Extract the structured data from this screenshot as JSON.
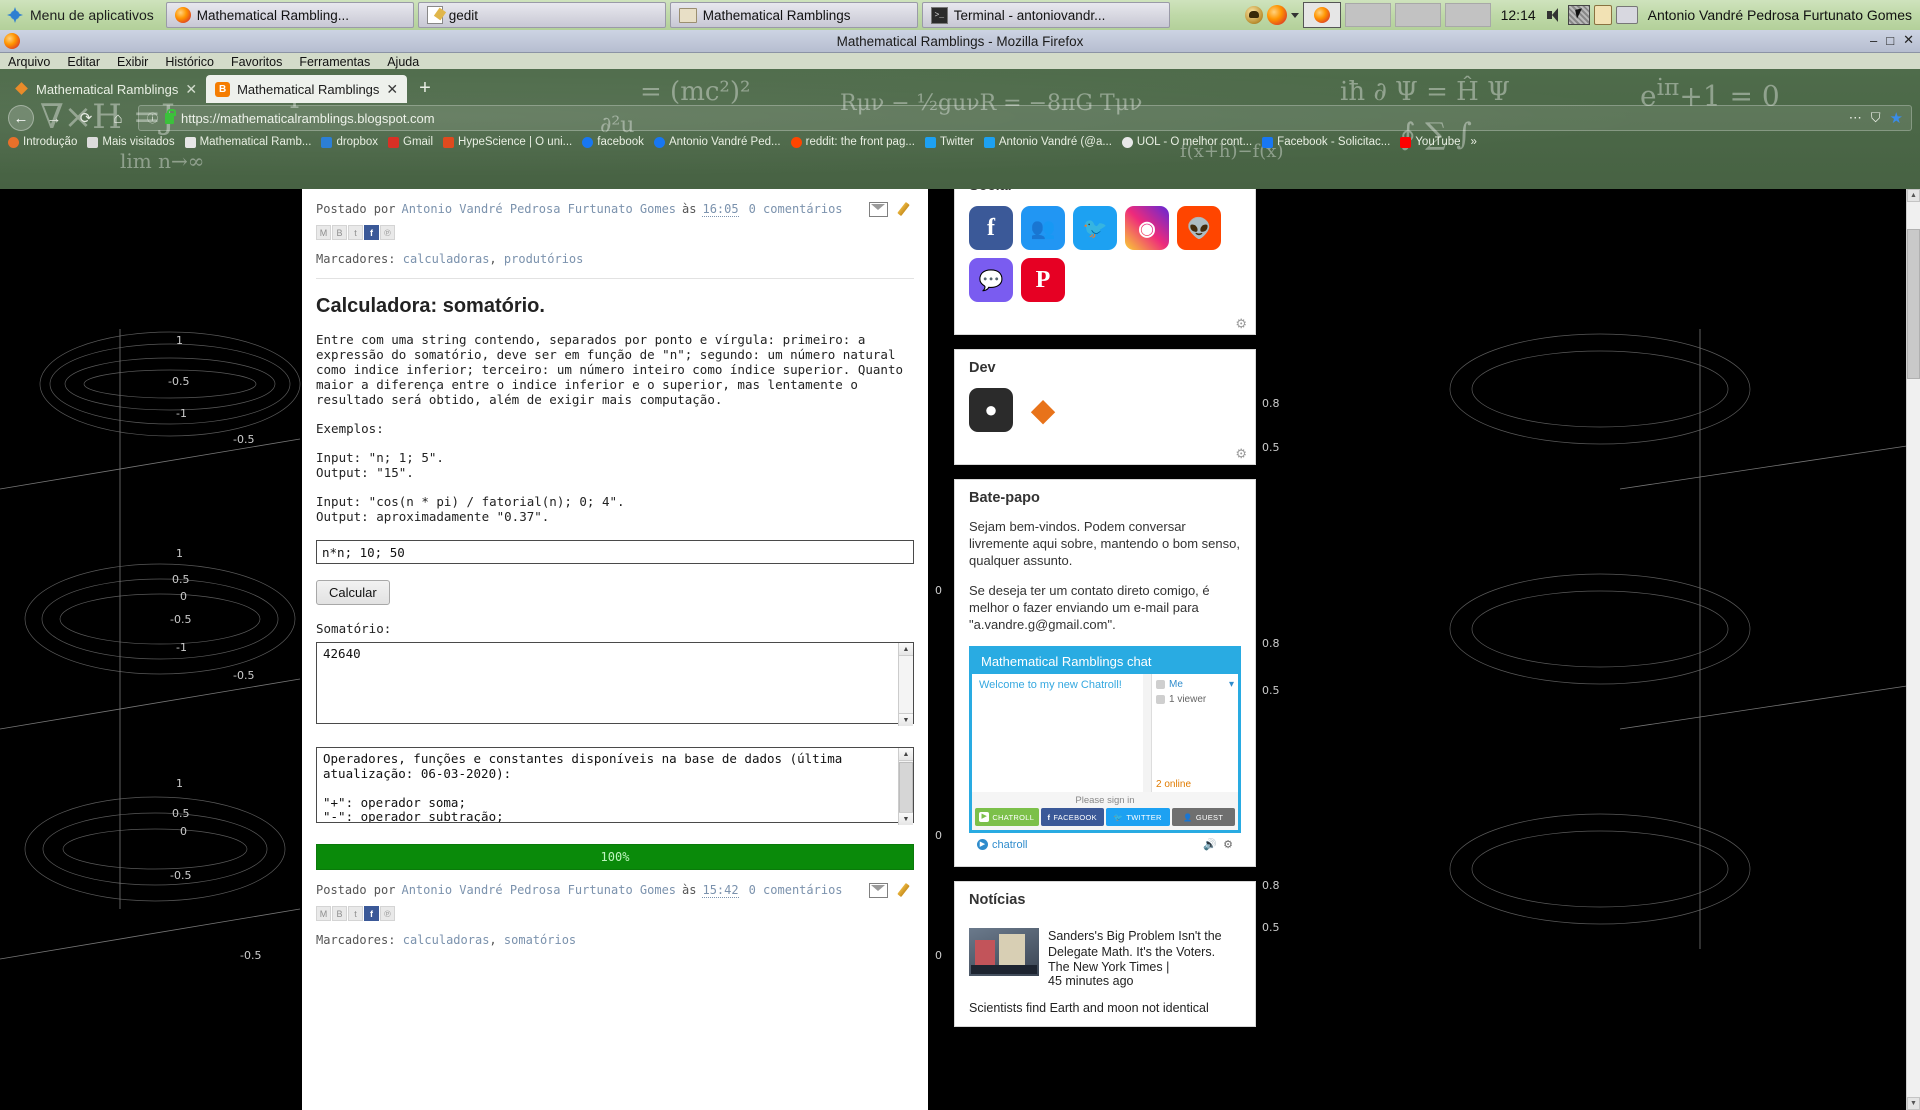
{
  "taskbar": {
    "app_menu": "Menu de aplicativos",
    "windows": [
      {
        "label": "Mathematical Rambling...",
        "icon": "firefox-icon"
      },
      {
        "label": "gedit",
        "icon": "gedit-icon"
      },
      {
        "label": "Mathematical Ramblings",
        "icon": "folder-icon"
      },
      {
        "label": "Terminal - antoniovandr...",
        "icon": "terminal-icon"
      }
    ],
    "tray": {
      "skull_icon": "skull-icon",
      "firefox_icon": "firefox-icon",
      "dropdown_icon": "chevron-down-icon",
      "selected_task_icon": "firefox-icon",
      "clock": "12:14",
      "volume_icon": "volume-muted-icon",
      "screenshot_icon": "screenshot-icon",
      "clipboard_icon": "clipboard-icon",
      "printer_icon": "printer-icon",
      "user": "Antonio Vandré Pedrosa Furtunato Gomes"
    }
  },
  "browser": {
    "window_title": "Mathematical Ramblings - Mozilla Firefox",
    "window_controls": {
      "minimize": "–",
      "maximize": "□",
      "close": "✕"
    },
    "menus": [
      "Arquivo",
      "Editar",
      "Exibir",
      "Histórico",
      "Favoritos",
      "Ferramentas",
      "Ajuda"
    ],
    "tabs": [
      {
        "label": "Mathematical Ramblings",
        "icon": "diamond-icon",
        "active": false,
        "close": "✕"
      },
      {
        "label": "Mathematical Ramblings",
        "icon": "blogger-icon",
        "active": true,
        "close": "✕"
      }
    ],
    "new_tab_label": "+",
    "nav": {
      "back": "←",
      "forward": "→",
      "reload": "⟳",
      "home": "⌂",
      "url": "https://mathematicalramblings.blogspot.com",
      "info_icon": "info-icon",
      "lock_icon": "lock-icon",
      "page_actions": "⋯",
      "shield_icon": "shield-icon",
      "bookmark_star": "★"
    },
    "bookmarks": [
      {
        "label": "Introdução",
        "color": "#e8702a"
      },
      {
        "label": "Mais visitados",
        "color": "#555555"
      },
      {
        "label": "Mathematical Ramb...",
        "color": "#dddddd"
      },
      {
        "label": "dropbox",
        "color": "#2c7fd6"
      },
      {
        "label": "Gmail",
        "color": "#d93025"
      },
      {
        "label": "HypeScience | O uni...",
        "color": "#e04a1e"
      },
      {
        "label": "facebook",
        "color": "#1877f2"
      },
      {
        "label": "Antonio Vandré Ped...",
        "color": "#1877f2"
      },
      {
        "label": "reddit: the front pag...",
        "color": "#ff4500"
      },
      {
        "label": "Twitter",
        "color": "#1da1f2"
      },
      {
        "label": "Antonio Vandré (@a...",
        "color": "#1da1f2"
      },
      {
        "label": "UOL - O melhor cont...",
        "color": "#cccccc"
      },
      {
        "label": "Facebook - Solicitac...",
        "color": "#1877f2"
      },
      {
        "label": "YouTube",
        "color": "#ff0000"
      }
    ],
    "bookmarks_overflow": "»"
  },
  "post_top": {
    "posted_by_prefix": "Postado por",
    "author": "Antonio Vandré Pedrosa Furtunato Gomes",
    "at": "às",
    "time": "16:05",
    "comments": "0 comentários",
    "email_icon": "email-post-icon",
    "edit_icon": "edit-pencil-icon",
    "share_icons": [
      "gmail-share-icon",
      "blogger-share-icon",
      "twitter-share-icon",
      "facebook-share-icon",
      "pinterest-share-icon"
    ],
    "labels_prefix": "Marcadores:",
    "labels": [
      "calculadoras",
      "produtórios"
    ]
  },
  "post": {
    "title": "Calculadora: somatório.",
    "paragraph": "Entre com uma string contendo, separados por ponto e vírgula: primeiro: a expressão do somatório, deve ser em função de \"n\"; segundo: um número natural como indice inferior; terceiro: um número inteiro como índice superior. Quanto maior a diferença entre o indice inferior e o superior, mas lentamente o resultado será obtido, além de exigir mais computação.",
    "examples_label": "Exemplos:",
    "example1_input": "Input: \"n; 1; 5\".",
    "example1_output": "Output: \"15\".",
    "example2_input": "Input: \"cos(n * pi) / fatorial(n); 0; 4\".",
    "example2_output": "Output: aproximadamente \"0.37\".",
    "input_value": "n*n; 10; 50",
    "calc_button": "Calcular",
    "result_label": "Somatório:",
    "result_value": "42640",
    "operators_text": "Operadores, funções e constantes disponíveis na base de dados (última atualização: 06-03-2020):\n\n\"+\": operador soma;\n\"-\": operador subtração;\n\"*\": operador multiplicação;\n\"/\": operador divisão;",
    "progress_label": "100%"
  },
  "post_bottom": {
    "posted_by_prefix": "Postado por",
    "author": "Antonio Vandré Pedrosa Furtunato Gomes",
    "at": "às",
    "time": "15:42",
    "comments": "0 comentários",
    "email_icon": "email-post-icon",
    "edit_icon": "edit-pencil-icon",
    "labels_prefix": "Marcadores:",
    "labels": [
      "calculadoras",
      "somatórios"
    ]
  },
  "sidebar": {
    "social": {
      "title": "Social",
      "icons": [
        {
          "name": "facebook-icon",
          "glyph": "f",
          "color": "#3b5998"
        },
        {
          "name": "facebook-group-icon",
          "glyph": "\u0001",
          "color": "#2196f3"
        },
        {
          "name": "twitter-icon",
          "glyph": "t",
          "color": "#1da1f2"
        },
        {
          "name": "instagram-icon",
          "glyph": "◎",
          "color": "#d6249f"
        },
        {
          "name": "reddit-icon",
          "glyph": "r",
          "color": "#ff4500"
        },
        {
          "name": "messenger-icon",
          "glyph": "m",
          "color": "#7a5cf0"
        },
        {
          "name": "pinterest-icon",
          "glyph": "P",
          "color": "#e60023"
        }
      ],
      "wrench_icon": "wrench-icon"
    },
    "dev": {
      "title": "Dev",
      "icons": [
        {
          "name": "github-icon",
          "glyph": "●",
          "color": "#2b2b2b"
        },
        {
          "name": "apache-netbeans-icon",
          "glyph": "◆",
          "color": "#e8731a"
        }
      ],
      "wrench_icon": "wrench-icon"
    },
    "chat": {
      "title": "Bate-papo",
      "paragraph1": "Sejam bem-vindos. Podem conversar livremente aqui sobre, mantendo o bom senso, qualquer assunto.",
      "paragraph2": "Se deseja ter um contato direto comigo, é melhor o fazer enviando um e-mail para \"a.vandre.g@gmail.com\".",
      "widget_title": "Mathematical Ramblings chat",
      "welcome": "Welcome to my new Chatroll!",
      "user_me": "Me",
      "viewers": "1 viewer",
      "online": "2 online",
      "signin": "Please sign in",
      "buttons": [
        {
          "label": "CHATROLL",
          "color": "#7cc04a",
          "icon": "chatroll-icon"
        },
        {
          "label": "FACEBOOK",
          "color": "#3b5998",
          "icon": "facebook-icon"
        },
        {
          "label": "TWITTER",
          "color": "#1da1f2",
          "icon": "twitter-icon"
        },
        {
          "label": "GUEST",
          "color": "#6f6f6f",
          "icon": "guest-icon"
        }
      ],
      "brand": "chatroll",
      "sound_icon": "sound-icon",
      "settings_icon": "wrench-icon"
    },
    "news": {
      "title": "Notícias",
      "items": [
        {
          "headline": "Sanders's Big Problem Isn't the Delegate Math. It's the Voters.",
          "source": "The New York Times |",
          "time": "45 minutes ago",
          "thumb": "news-thumbnail"
        },
        {
          "headline": "Scientists find Earth and moon not identical",
          "source": "",
          "time": "",
          "thumb": ""
        }
      ]
    }
  }
}
